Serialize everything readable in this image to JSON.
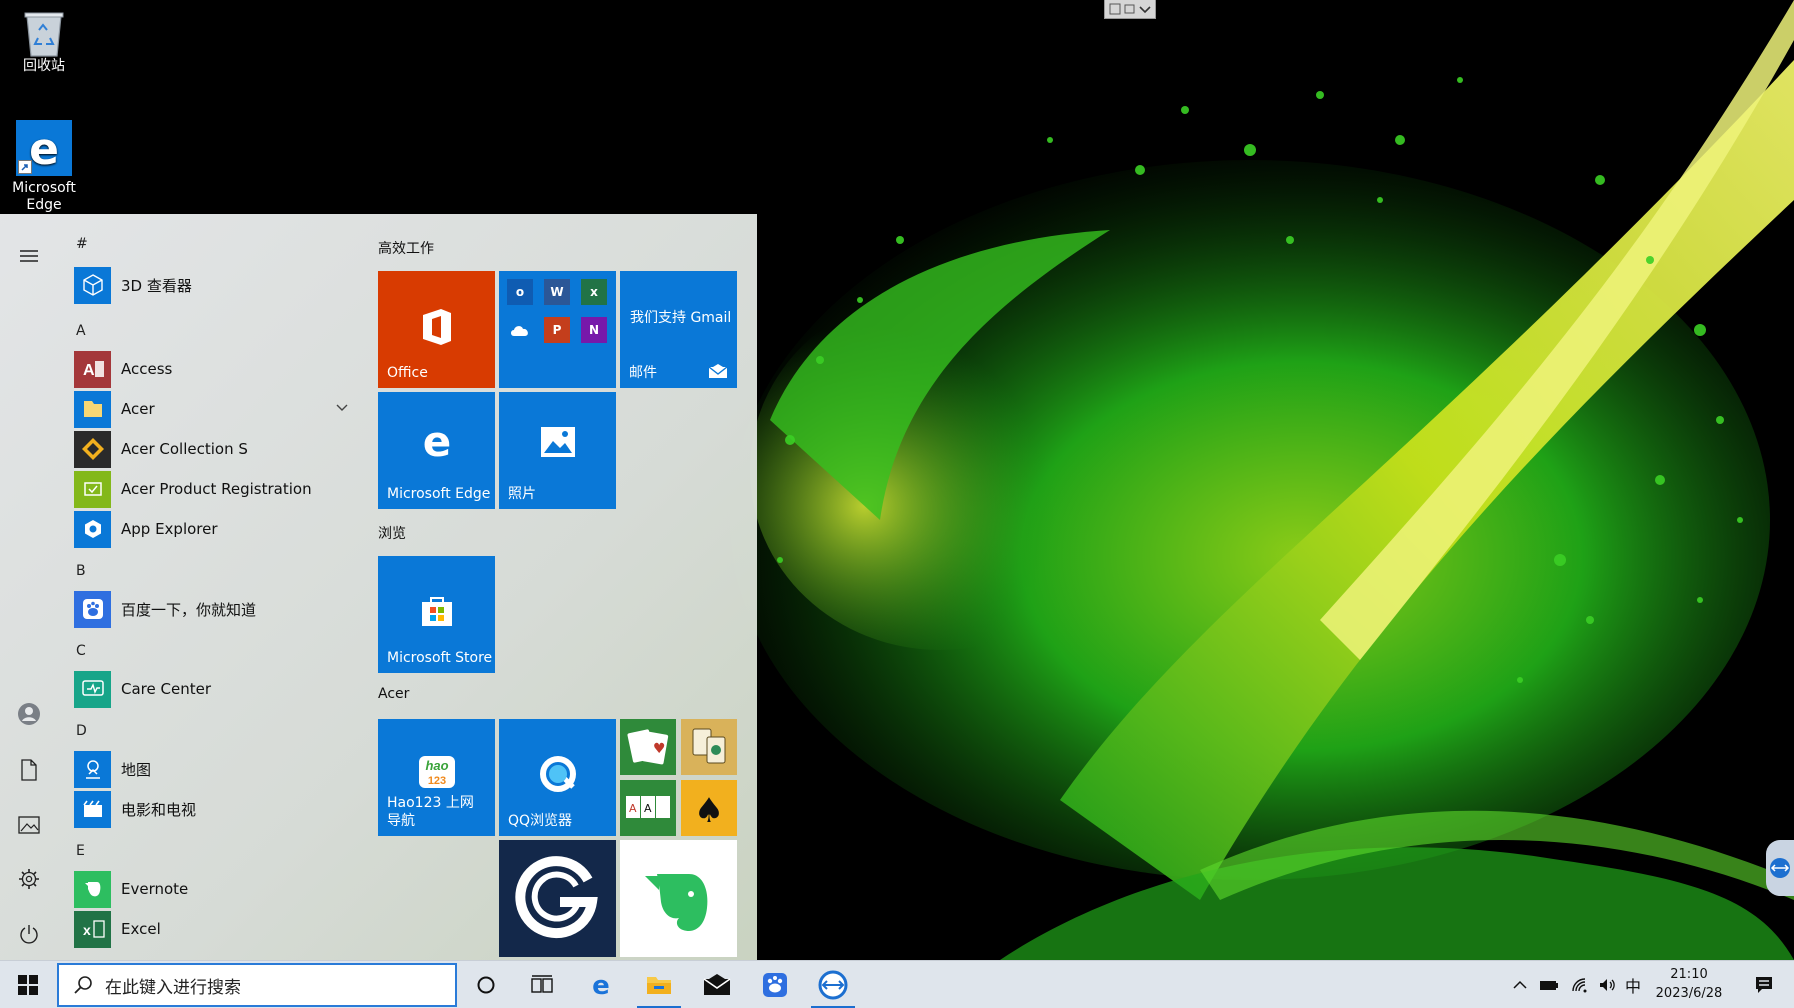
{
  "desktop": {
    "icons": [
      {
        "label": "回收站"
      },
      {
        "label": "Microsoft Edge"
      }
    ]
  },
  "start_menu": {
    "app_list": [
      {
        "letter": "#"
      },
      {
        "name": "3D 查看器"
      },
      {
        "letter": "A"
      },
      {
        "name": "Access"
      },
      {
        "name": "Acer"
      },
      {
        "name": "Acer Collection S"
      },
      {
        "name": "Acer Product Registration"
      },
      {
        "name": "App Explorer"
      },
      {
        "letter": "B"
      },
      {
        "name": "百度一下，你就知道"
      },
      {
        "letter": "C"
      },
      {
        "name": "Care Center"
      },
      {
        "letter": "D"
      },
      {
        "name": "地图"
      },
      {
        "name": "电影和电视"
      },
      {
        "letter": "E"
      },
      {
        "name": "Evernote"
      },
      {
        "name": "Excel"
      }
    ],
    "groups": [
      {
        "title": "高效工作"
      },
      {
        "title": "浏览"
      },
      {
        "title": "Acer"
      }
    ],
    "tiles": {
      "office": "Office",
      "mail_tagline": "我们支持 Gmail",
      "mail": "邮件",
      "edge": "Microsoft Edge",
      "photos": "照片",
      "store": "Microsoft Store",
      "hao123": "Hao123 上网导航",
      "qq_browser": "QQ浏览器"
    }
  },
  "taskbar": {
    "search_placeholder": "在此键入进行搜索",
    "ime": "中",
    "time": "21:10",
    "date": "2023/6/28"
  },
  "colors": {
    "tile_blue": "#0a78d7",
    "office_red": "#d83b01",
    "accent": "#1c6fd0"
  }
}
